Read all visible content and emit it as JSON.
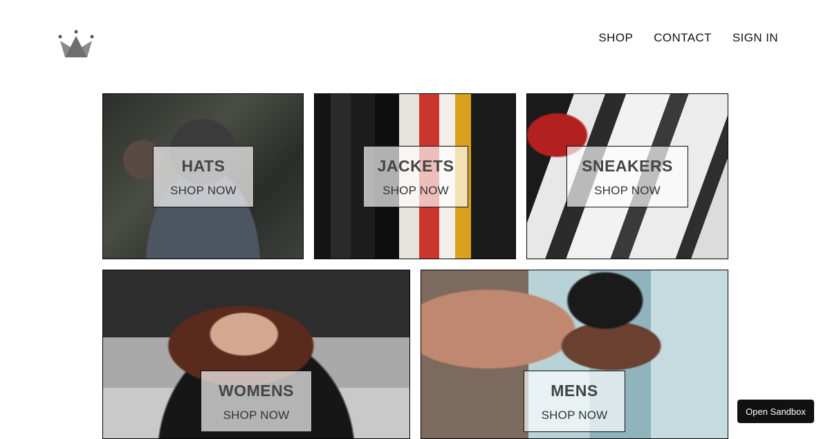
{
  "nav": {
    "items": [
      {
        "label": "SHOP"
      },
      {
        "label": "CONTACT"
      },
      {
        "label": "SIGN IN"
      }
    ]
  },
  "directory": {
    "sections": [
      {
        "title": "HATS",
        "cta": "SHOP NOW"
      },
      {
        "title": "JACKETS",
        "cta": "SHOP NOW"
      },
      {
        "title": "SNEAKERS",
        "cta": "SHOP NOW"
      },
      {
        "title": "WOMENS",
        "cta": "SHOP NOW"
      },
      {
        "title": "MENS",
        "cta": "SHOP NOW"
      }
    ]
  },
  "sandbox": {
    "label": "Open Sandbox"
  },
  "colors": {
    "text": "#111111",
    "title": "#444444",
    "border": "#000000"
  }
}
